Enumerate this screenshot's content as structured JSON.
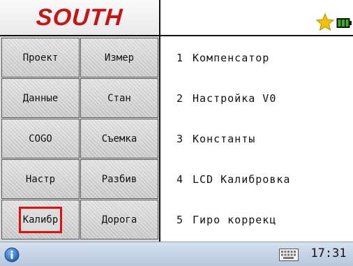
{
  "header": {
    "logo_text": "SOUTH",
    "star_icon": "star-icon",
    "battery_icon": "battery-icon"
  },
  "grid": {
    "buttons": [
      {
        "label": "Проект",
        "selected": false
      },
      {
        "label": "Измер",
        "selected": false
      },
      {
        "label": "Данные",
        "selected": false
      },
      {
        "label": "Стан",
        "selected": false
      },
      {
        "label": "COGO",
        "selected": false
      },
      {
        "label": "Съемка",
        "selected": false
      },
      {
        "label": "Настр",
        "selected": false
      },
      {
        "label": "Разбив",
        "selected": false
      },
      {
        "label": "Калибр",
        "selected": true
      },
      {
        "label": "Дорога",
        "selected": false
      }
    ]
  },
  "menu": {
    "items": [
      {
        "num": "1",
        "label": "Компенсатор"
      },
      {
        "num": "2",
        "label": "Настройка V0"
      },
      {
        "num": "3",
        "label": "Константы"
      },
      {
        "num": "4",
        "label": "LCD Калибровка"
      },
      {
        "num": "5",
        "label": "Гиро коррекц"
      }
    ]
  },
  "status": {
    "time": "17:31",
    "info_icon": "info-icon",
    "keyboard_icon": "keyboard-icon"
  },
  "colors": {
    "logo": "#c41616",
    "selection": "#e01010",
    "star": "#f2c200",
    "battery": "#2f8f1a",
    "status_bar": "#c6d3e6"
  }
}
